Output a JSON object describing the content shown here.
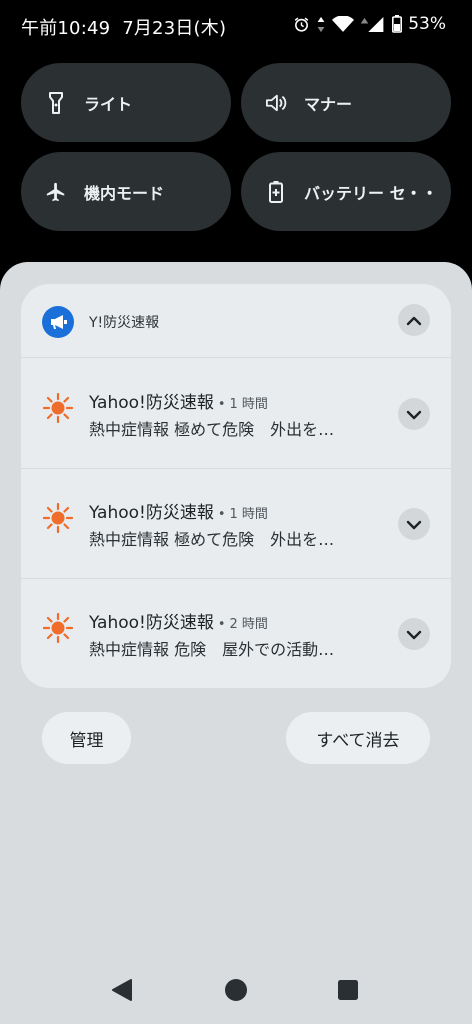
{
  "status_bar": {
    "time": "午前10:49",
    "date": "7月23日(木)",
    "battery": "53%",
    "icons": [
      "alarm-icon",
      "data-arrows-icon",
      "wifi-icon",
      "cellular-icon",
      "battery-icon"
    ]
  },
  "quick_settings": {
    "tiles": [
      {
        "label": "ライト",
        "icon": "flashlight-icon"
      },
      {
        "label": "マナー",
        "icon": "volume-icon"
      },
      {
        "label": "機内モード",
        "icon": "airplane-icon"
      },
      {
        "label": "バッテリー セ・・",
        "icon": "battery-saver-icon"
      }
    ]
  },
  "notification_group": {
    "app_name": "Y!防災速報",
    "app_icon": "megaphone-icon",
    "items": [
      {
        "title": "Yahoo!防災速報",
        "time": "1 時間",
        "text": "熱中症情報 極めて危険　外出を…",
        "icon": "sun-icon"
      },
      {
        "title": "Yahoo!防災速報",
        "time": "1 時間",
        "text": "熱中症情報 極めて危険　外出を…",
        "icon": "sun-icon"
      },
      {
        "title": "Yahoo!防災速報",
        "time": "2 時間",
        "text": "熱中症情報 危険　屋外での活動…",
        "icon": "sun-icon"
      }
    ],
    "separator": "•"
  },
  "actions": {
    "manage_label": "管理",
    "clear_all_label": "すべて消去"
  },
  "colors": {
    "tile_bg": "#2b3033",
    "shade_bg": "#d8dcdf",
    "card_bg": "#e8ecee",
    "app_icon_blue": "#1a6fd8",
    "sun_orange": "#ef6c2a"
  }
}
